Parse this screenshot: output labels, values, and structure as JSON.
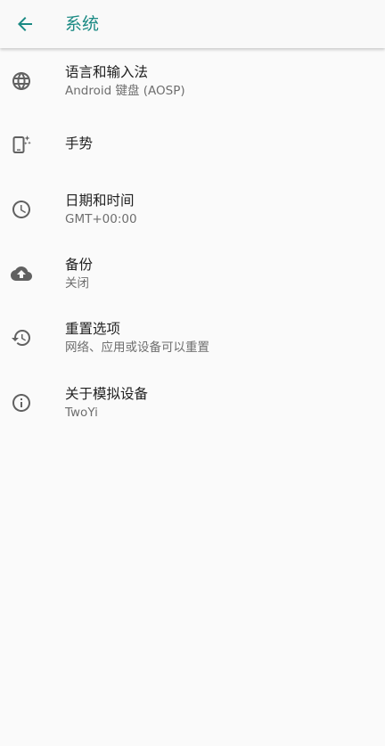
{
  "toolbar": {
    "title": "系统",
    "back_icon": "arrow-back-icon"
  },
  "colors": {
    "accent": "#1b8a84",
    "icon": "#616161",
    "title_text": "#212121",
    "summary_text": "#6e6e6e",
    "background": "#fafafa"
  },
  "settings": [
    {
      "icon": "globe-icon",
      "title": "语言和输入法",
      "summary": "Android 键盘 (AOSP)"
    },
    {
      "icon": "gesture-phone-icon",
      "title": "手势"
    },
    {
      "icon": "clock-icon",
      "title": "日期和时间",
      "summary": "GMT+00:00"
    },
    {
      "icon": "cloud-upload-icon",
      "title": "备份",
      "summary": "关闭"
    },
    {
      "icon": "restore-icon",
      "title": "重置选项",
      "summary": "网络、应用或设备可以重置"
    },
    {
      "icon": "info-icon",
      "title": "关于模拟设备",
      "summary": "TwoYi"
    }
  ]
}
